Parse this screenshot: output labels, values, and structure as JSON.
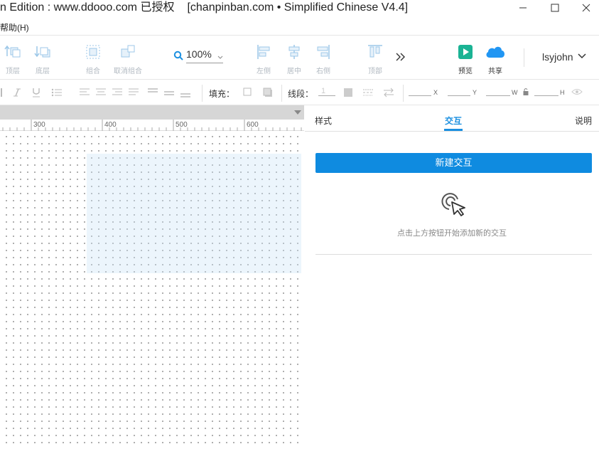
{
  "window": {
    "title": "n Edition : www.ddooo.com 已授权",
    "subtitle": "[chanpinban.com • Simplified Chinese V4.4]"
  },
  "menu": {
    "help": "帮助(H)"
  },
  "toolbar": {
    "top_label": "顶层",
    "bottom_label": "底层",
    "group_label": "组合",
    "ungroup_label": "取消组合",
    "zoom_value": "100%",
    "align_left_label": "左侧",
    "align_center_label": "居中",
    "align_right_label": "右侧",
    "align_top_label": "顶部",
    "preview_label": "预览",
    "share_label": "共享",
    "username": "lsyjohn"
  },
  "format": {
    "fill_label": "填充：",
    "line_label": "线段：",
    "line_width": "1",
    "x_label": "X",
    "y_label": "Y",
    "w_label": "W",
    "h_label": "H"
  },
  "ruler": {
    "ticks": [
      "300",
      "400",
      "500",
      "600"
    ]
  },
  "panel": {
    "tab_style": "样式",
    "tab_interaction": "交互",
    "tab_notes": "说明",
    "new_interaction": "新建交互",
    "hint": "点击上方按钮开始添加新的交互"
  },
  "colors": {
    "accent": "#0f8be0",
    "preview_green": "#1ab394",
    "share_blue": "#2196f3"
  }
}
